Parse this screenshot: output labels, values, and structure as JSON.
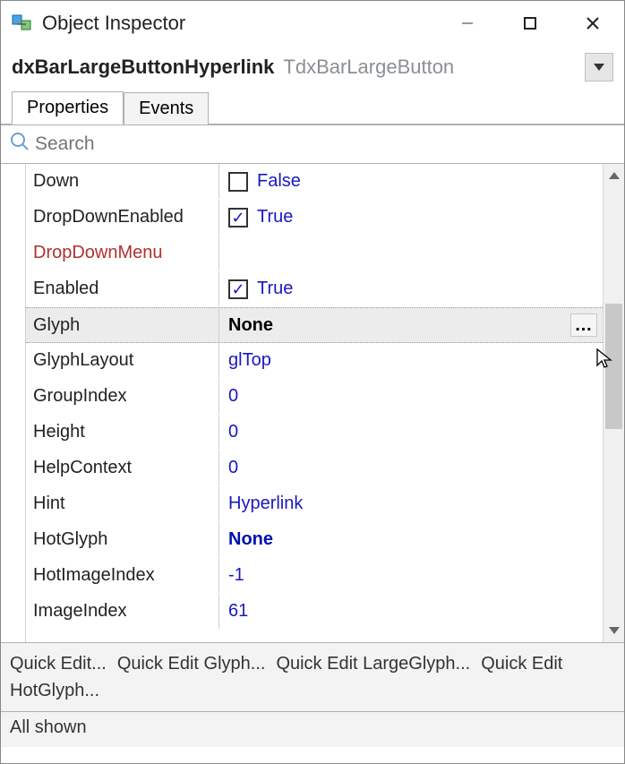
{
  "window": {
    "title": "Object Inspector"
  },
  "object": {
    "name": "dxBarLargeButtonHyperlink",
    "type": "TdxBarLargeButton"
  },
  "tabs": [
    {
      "label": "Properties",
      "active": true
    },
    {
      "label": "Events",
      "active": false
    }
  ],
  "search": {
    "placeholder": "Search"
  },
  "properties": [
    {
      "name": "Down",
      "valueText": "False",
      "kind": "bool",
      "checked": false
    },
    {
      "name": "DropDownEnabled",
      "valueText": "True",
      "kind": "bool",
      "checked": true
    },
    {
      "name": "DropDownMenu",
      "valueText": "",
      "kind": "ref",
      "danger": true
    },
    {
      "name": "Enabled",
      "valueText": "True",
      "kind": "bool",
      "checked": true
    },
    {
      "name": "Glyph",
      "valueText": "None",
      "kind": "dialog",
      "expandable": true,
      "selected": true,
      "bold": true
    },
    {
      "name": "GlyphLayout",
      "valueText": "glTop",
      "kind": "enum"
    },
    {
      "name": "GroupIndex",
      "valueText": "0",
      "kind": "int"
    },
    {
      "name": "Height",
      "valueText": "0",
      "kind": "int"
    },
    {
      "name": "HelpContext",
      "valueText": "0",
      "kind": "int"
    },
    {
      "name": "Hint",
      "valueText": "Hyperlink",
      "kind": "str"
    },
    {
      "name": "HotGlyph",
      "valueText": "None",
      "kind": "dialog",
      "expandable": true,
      "bold": true
    },
    {
      "name": "HotImageIndex",
      "valueText": "-1",
      "kind": "int"
    },
    {
      "name": "ImageIndex",
      "valueText": "61",
      "kind": "int"
    }
  ],
  "quickEdit": [
    "Quick Edit...",
    "Quick Edit Glyph...",
    "Quick Edit LargeGlyph...",
    "Quick Edit HotGlyph..."
  ],
  "status": "All shown"
}
